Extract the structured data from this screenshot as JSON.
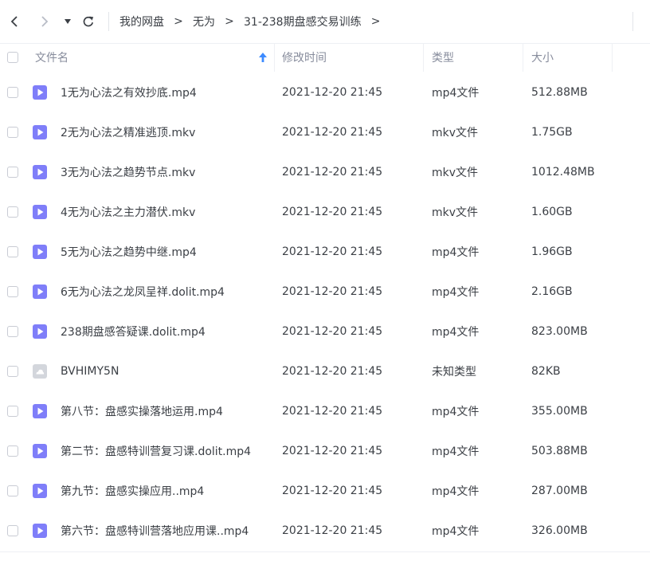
{
  "breadcrumb": {
    "items": [
      "我的网盘",
      "无为",
      "31-238期盘感交易训练"
    ],
    "separator": ">"
  },
  "header": {
    "name": "文件名",
    "modified": "修改时间",
    "type": "类型",
    "size": "大小",
    "sort_direction": "ascending"
  },
  "colors": {
    "accent": "#3d8bff",
    "video_icon": "#7f7ef9",
    "unknown_icon": "#c9ccd4",
    "text": "#3b3f45",
    "muted": "#878c9c"
  },
  "files": [
    {
      "name": "1无为心法之有效抄底.mp4",
      "modified": "2021-12-20 21:45",
      "type": "mp4文件",
      "size": "512.88MB",
      "icon": "video-file-icon"
    },
    {
      "name": "2无为心法之精准逃顶.mkv",
      "modified": "2021-12-20 21:45",
      "type": "mkv文件",
      "size": "1.75GB",
      "icon": "video-file-icon"
    },
    {
      "name": "3无为心法之趋势节点.mkv",
      "modified": "2021-12-20 21:45",
      "type": "mkv文件",
      "size": "1012.48MB",
      "icon": "video-file-icon"
    },
    {
      "name": "4无为心法之主力潜伏.mkv",
      "modified": "2021-12-20 21:45",
      "type": "mkv文件",
      "size": "1.60GB",
      "icon": "video-file-icon"
    },
    {
      "name": "5无为心法之趋势中继.mp4",
      "modified": "2021-12-20 21:45",
      "type": "mp4文件",
      "size": "1.96GB",
      "icon": "video-file-icon"
    },
    {
      "name": "6无为心法之龙凤呈祥.dolit.mp4",
      "modified": "2021-12-20 21:45",
      "type": "mp4文件",
      "size": "2.16GB",
      "icon": "video-file-icon"
    },
    {
      "name": "238期盘感答疑课.dolit.mp4",
      "modified": "2021-12-20 21:45",
      "type": "mp4文件",
      "size": "823.00MB",
      "icon": "video-file-icon"
    },
    {
      "name": "BVHIMY5N",
      "modified": "2021-12-20 21:45",
      "type": "未知类型",
      "size": "82KB",
      "icon": "unknown-file-icon"
    },
    {
      "name": "第八节：盘感实操落地运用.mp4",
      "modified": "2021-12-20 21:45",
      "type": "mp4文件",
      "size": "355.00MB",
      "icon": "video-file-icon"
    },
    {
      "name": "第二节：盘感特训营复习课.dolit.mp4",
      "modified": "2021-12-20 21:45",
      "type": "mp4文件",
      "size": "503.88MB",
      "icon": "video-file-icon"
    },
    {
      "name": "第九节：盘感实操应用..mp4",
      "modified": "2021-12-20 21:45",
      "type": "mp4文件",
      "size": "287.00MB",
      "icon": "video-file-icon"
    },
    {
      "name": "第六节：盘感特训营落地应用课..mp4",
      "modified": "2021-12-20 21:45",
      "type": "mp4文件",
      "size": "326.00MB",
      "icon": "video-file-icon"
    }
  ]
}
